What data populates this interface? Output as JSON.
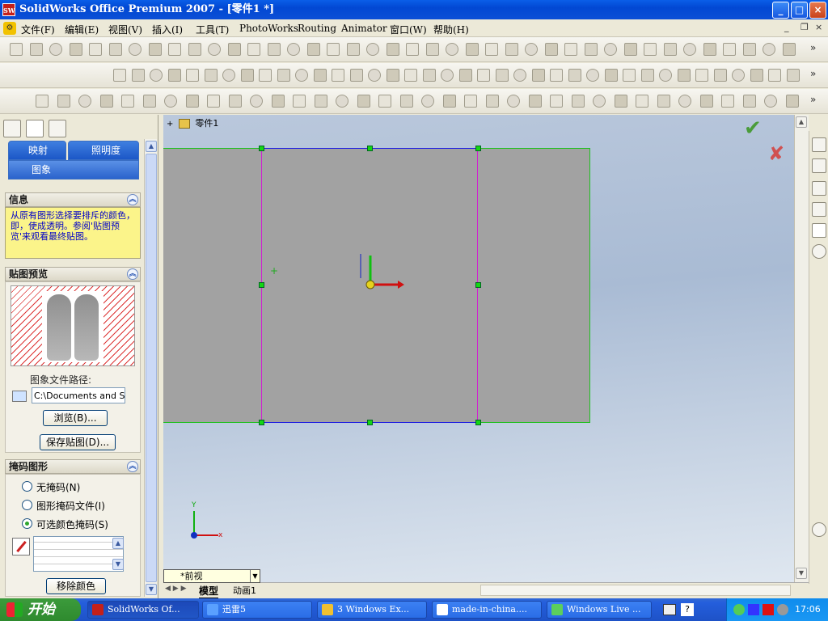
{
  "window": {
    "title": "SolidWorks Office Premium 2007 - [零件1 *]",
    "app_icon_text": "SW",
    "controls": {
      "minimize": "_",
      "maximize": "□",
      "close": "×"
    }
  },
  "menubar": {
    "items": [
      "文件(F)",
      "编辑(E)",
      "视图(V)",
      "插入(I)",
      "工具(T)",
      "PhotoWorks",
      "Routing",
      "Animator",
      "窗口(W)",
      "帮助(H)"
    ],
    "doc_controls": {
      "minimize": "_",
      "restore": "❐",
      "close": "×"
    }
  },
  "toolbars": {
    "row1_icons": [
      "new-doc",
      "open",
      "save",
      "print",
      "preview",
      "undo",
      "redo",
      "rebuild",
      "options",
      "camera"
    ],
    "overflow": "»"
  },
  "left_panel": {
    "tabs": {
      "mapping": "映射",
      "illumination": "照明度",
      "image": "图象"
    },
    "info": {
      "header": "信息",
      "text": "从原有图形选择要排斥的颜色，即，使成透明。参阅'贴图预览'来观看最终贴图。"
    },
    "preview": {
      "header": "贴图预览",
      "path_label": "图象文件路径:",
      "path_value": "C:\\Documents and Sett",
      "browse": "浏览(B)...",
      "save": "保存贴图(D)..."
    },
    "mask": {
      "header": "掩码图形",
      "options": [
        "无掩码(N)",
        "图形掩码文件(I)",
        "可选颜色掩码(S)"
      ],
      "selected": 2,
      "remove_color": "移除颜色"
    },
    "collapse_symbol": "︽"
  },
  "canvas": {
    "tree_label": "零件1",
    "ok_symbol": "✔",
    "cancel_symbol": "✘",
    "axis_x": "x",
    "axis_y": "Y",
    "view_name": "*前视",
    "tabs": [
      "模型",
      "动画1"
    ]
  },
  "taskbar": {
    "start": "开始",
    "items": [
      "SolidWorks Of...",
      "迅雷5",
      "3 Windows Ex...",
      "made-in-china....",
      "Windows Live ..."
    ],
    "clock": "17:06"
  },
  "colors": {
    "accent": "#0a5ee8",
    "part": "#a2a2a2",
    "handle": "#14d614"
  }
}
